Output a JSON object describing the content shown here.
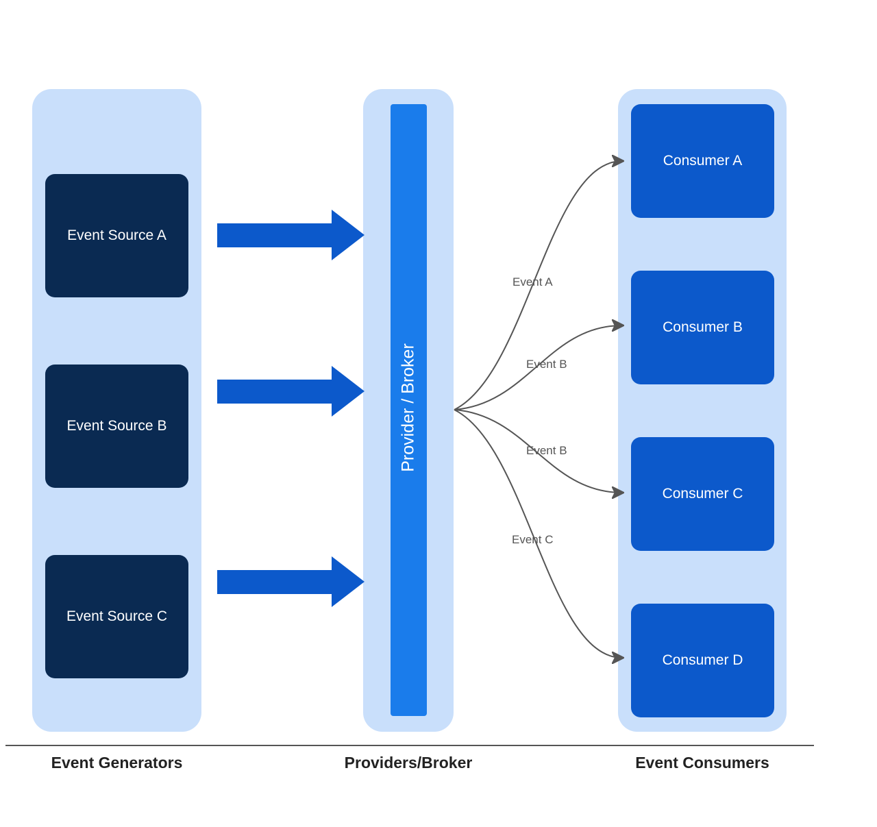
{
  "diagram": {
    "columns": {
      "generators": {
        "caption": "Event Generators",
        "sources": [
          {
            "label": "Event Source A"
          },
          {
            "label": "Event Source B"
          },
          {
            "label": "Event Source C"
          }
        ]
      },
      "broker": {
        "caption": "Providers/Broker",
        "label": "Provider / Broker"
      },
      "consumers": {
        "caption": "Event Consumers",
        "items": [
          {
            "label": "Consumer A"
          },
          {
            "label": "Consumer B"
          },
          {
            "label": "Consumer C"
          },
          {
            "label": "Consumer D"
          }
        ]
      }
    },
    "routes": [
      {
        "label": "Event A"
      },
      {
        "label": "Event B"
      },
      {
        "label": "Event B"
      },
      {
        "label": "Event C"
      }
    ]
  }
}
